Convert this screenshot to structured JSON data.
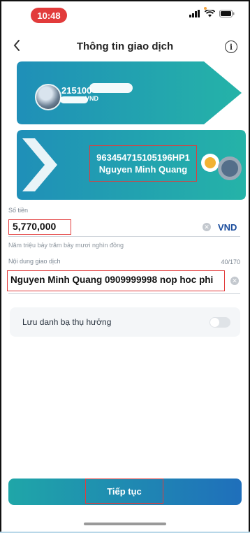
{
  "status_bar": {
    "time": "10:48",
    "icons": [
      "signal-icon",
      "wifi-icon",
      "battery-icon"
    ]
  },
  "header": {
    "title": "Thông tin giao dịch",
    "back_icon": "chevron-left-icon",
    "info_icon": "info-icon"
  },
  "source_account": {
    "account_number_visible": "215100",
    "balance_suffix": "VND"
  },
  "beneficiary": {
    "account_number": "963454715105196HP1",
    "name": "Nguyen Minh Quang"
  },
  "amount": {
    "label": "Số tiền",
    "value": "5,770,000",
    "currency": "VND",
    "in_words": "Năm triệu bảy trăm bảy mươi nghìn đồng"
  },
  "content": {
    "label": "Nội dung giao dịch",
    "char_count": "40/170",
    "value": "Nguyen Minh Quang 0909999998 nop hoc phi"
  },
  "save_contact": {
    "label": "Lưu danh bạ thụ hưởng",
    "enabled": false
  },
  "actions": {
    "continue_label": "Tiếp tục"
  },
  "colors": {
    "accent_gradient_start": "#1fa6a8",
    "accent_gradient_end": "#1f6fbb",
    "highlight_red": "#e23b3b",
    "currency_blue": "#1a4c9c"
  }
}
